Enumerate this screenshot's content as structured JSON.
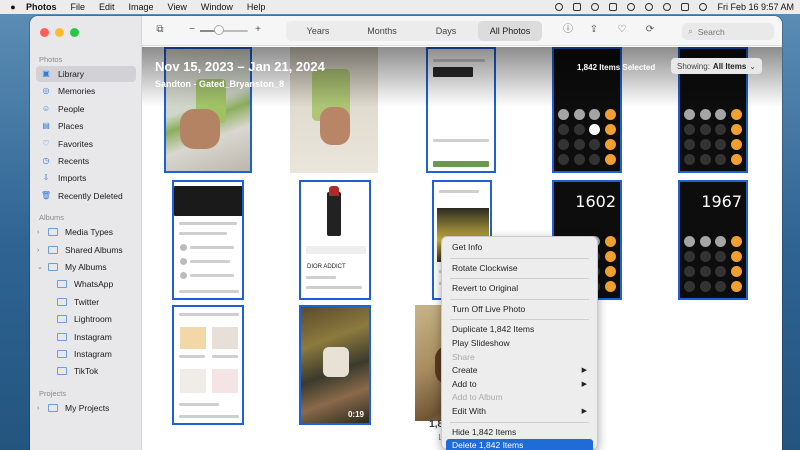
{
  "menubar": {
    "app": "Photos",
    "items": [
      "File",
      "Edit",
      "Image",
      "View",
      "Window",
      "Help"
    ],
    "clock": "Fri Feb 16  9:57 AM"
  },
  "sidebar": {
    "photos_header": "Photos",
    "photos_items": [
      {
        "label": "Library",
        "icon": "photo-library-icon"
      },
      {
        "label": "Memories",
        "icon": "memories-icon"
      },
      {
        "label": "People",
        "icon": "people-icon"
      },
      {
        "label": "Places",
        "icon": "places-icon"
      },
      {
        "label": "Favorites",
        "icon": "heart-icon"
      },
      {
        "label": "Recents",
        "icon": "clock-icon"
      },
      {
        "label": "Imports",
        "icon": "import-icon"
      },
      {
        "label": "Recently Deleted",
        "icon": "trash-icon"
      }
    ],
    "albums_header": "Albums",
    "albums_items": [
      {
        "label": "Media Types"
      },
      {
        "label": "Shared Albums"
      },
      {
        "label": "My Albums"
      }
    ],
    "my_albums": [
      "WhatsApp",
      "Twitter",
      "Lightroom",
      "Instagram",
      "Instagram",
      "TikTok"
    ],
    "projects_header": "Projects",
    "projects_items": [
      {
        "label": "My Projects"
      }
    ]
  },
  "toolbar": {
    "tabs": [
      "Years",
      "Months",
      "Days",
      "All Photos"
    ],
    "active_tab": "All Photos",
    "search_placeholder": "Search",
    "zoom_level": 0.42,
    "zoom_minus": "−",
    "zoom_plus": "+"
  },
  "header": {
    "date_range": "Nov 15, 2023 – Jan 21, 2024",
    "location": "Sandton - Gated_Bryanston_8",
    "selected": "1,842 Items Selected",
    "showing_label": "Showing:",
    "showing_value": "All Items"
  },
  "thumbs": {
    "calc_1": "1602",
    "calc_2": "1967",
    "video_duration": "0:19",
    "dior_text": "DIOR ADDICT"
  },
  "footer": {
    "count": "1,834 Photos",
    "update": "Last Update"
  },
  "context_menu": [
    {
      "label": "Get Info"
    },
    {
      "sep": true
    },
    {
      "label": "Rotate Clockwise"
    },
    {
      "sep": true
    },
    {
      "label": "Revert to Original"
    },
    {
      "sep": true
    },
    {
      "label": "Turn Off Live Photo"
    },
    {
      "sep": true
    },
    {
      "label": "Duplicate 1,842 Items"
    },
    {
      "label": "Play Slideshow"
    },
    {
      "label": "Share",
      "disabled": true
    },
    {
      "label": "Create",
      "submenu": true
    },
    {
      "label": "Add to",
      "submenu": true
    },
    {
      "label": "Add to Album",
      "disabled": true
    },
    {
      "label": "Edit With",
      "submenu": true
    },
    {
      "sep": true
    },
    {
      "label": "Hide 1,842 Items"
    },
    {
      "label": "Delete 1,842 Items",
      "highlighted": true
    }
  ],
  "colors": {
    "accent": "#1f6bd8",
    "calc_orange": "#f0a030",
    "selection": "#1b62d8"
  }
}
